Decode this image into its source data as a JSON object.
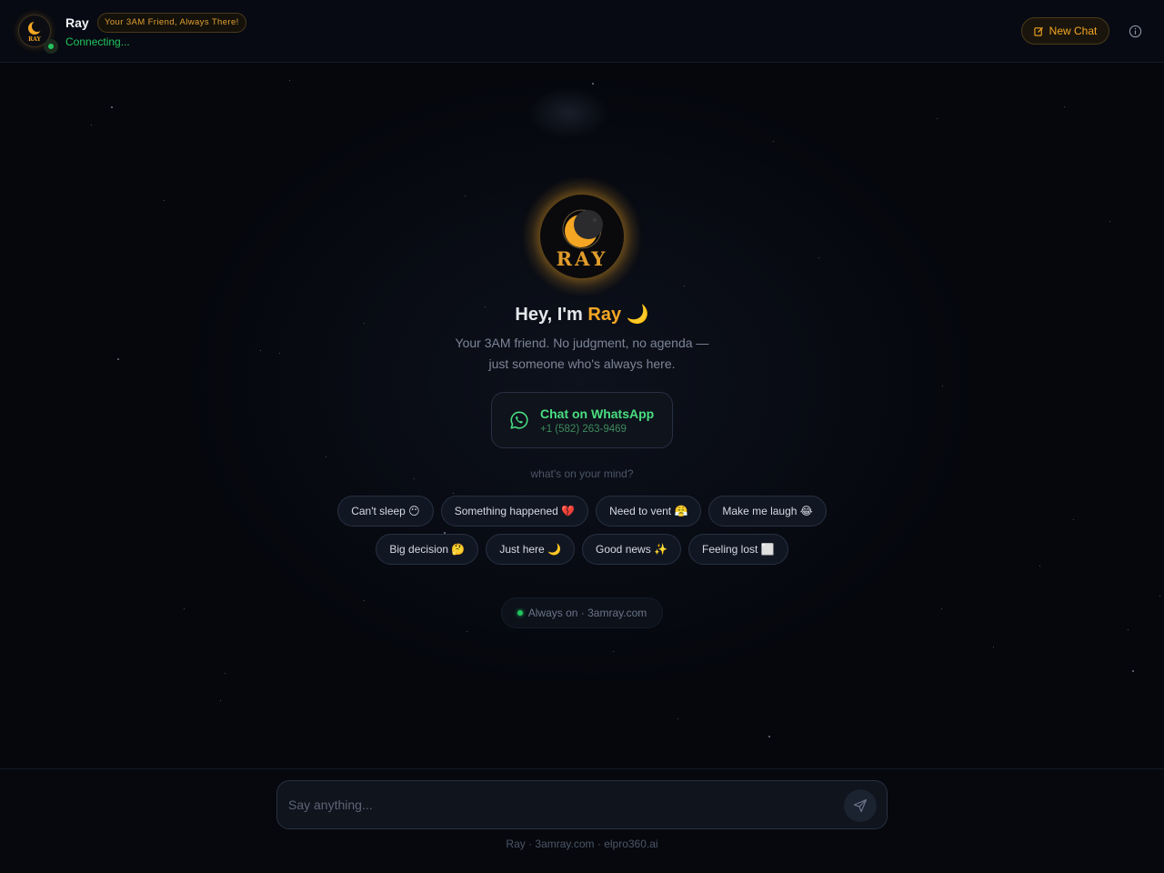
{
  "header": {
    "name": "Ray",
    "tagline": "Your 3AM Friend, Always There!",
    "status": "Connecting...",
    "new_chat_label": "New Chat",
    "logo_text": "RAY"
  },
  "hero": {
    "title_prefix": "Hey, I'm ",
    "title_name": "Ray",
    "title_emoji": "🌙",
    "subtitle_line1": "Your 3AM friend. No judgment, no agenda —",
    "subtitle_line2": "just someone who's always here.",
    "logo_text": "RAY"
  },
  "whatsapp": {
    "title": "Chat on WhatsApp",
    "number": "+1 (582) 263-9469"
  },
  "prompt_label": "what's on your mind?",
  "chips_row1": [
    {
      "label": "Can't sleep 😶"
    },
    {
      "label": "Something happened 💔"
    },
    {
      "label": "Need to vent 😤"
    },
    {
      "label": "Make me laugh 😂"
    }
  ],
  "chips_row2": [
    {
      "label": "Big decision 🤔"
    },
    {
      "label": "Just here 🌙"
    },
    {
      "label": "Good news ✨"
    },
    {
      "label": "Feeling lost ⬜"
    }
  ],
  "always_on": "Always on · 3amray.com",
  "composer": {
    "placeholder": "Say anything..."
  },
  "footer": "Ray · 3amray.com · elpro360.ai",
  "colors": {
    "accent": "#f5a623",
    "online": "#22c55e",
    "whatsapp": "#4ade80",
    "background": "#05070d"
  }
}
